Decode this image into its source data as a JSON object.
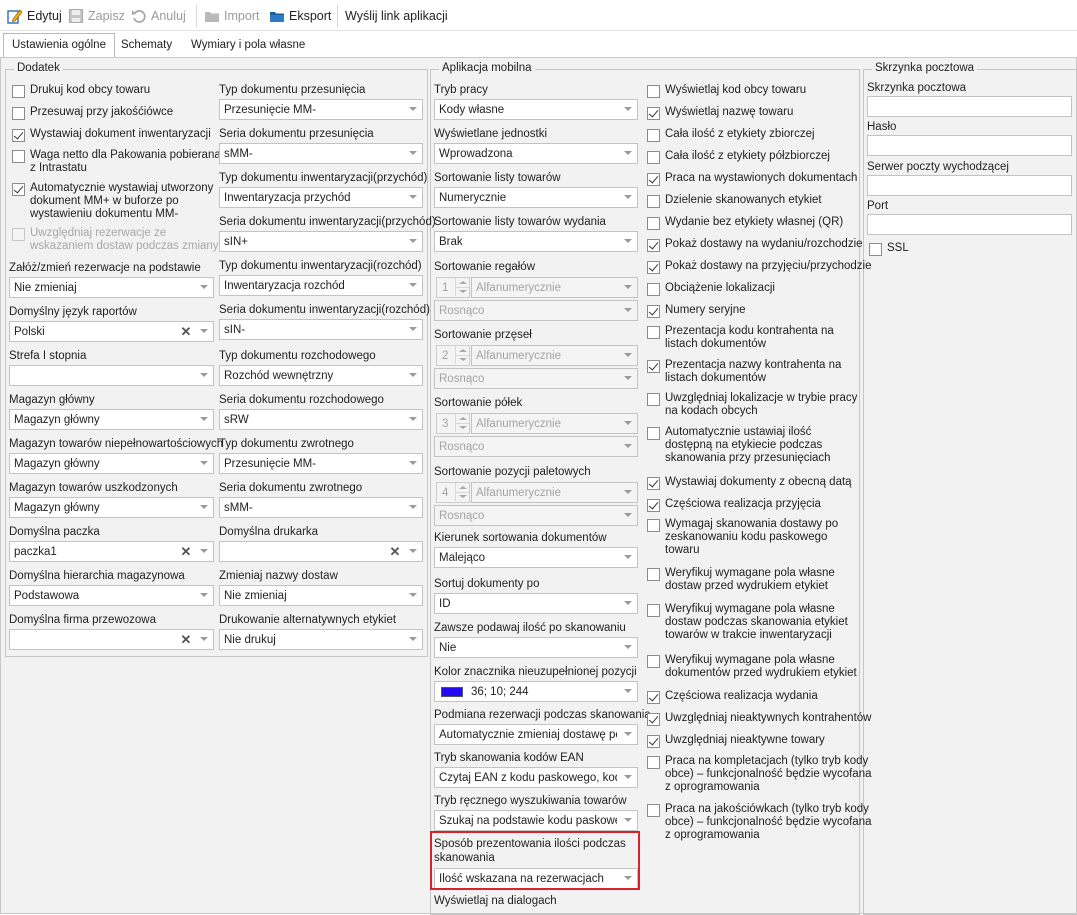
{
  "toolbar": {
    "edit": "Edytuj",
    "save": "Zapisz",
    "cancel": "Anuluj",
    "import": "Import",
    "export": "Eksport",
    "send_link": "Wyślij link aplikacji"
  },
  "tabs": [
    "Ustawienia ogólne",
    "Schematy",
    "Wymiary i pola własne"
  ],
  "dodatek": {
    "title": "Dodatek",
    "checkboxes": [
      {
        "label": "Drukuj kod obcy towaru",
        "checked": false
      },
      {
        "label": "Przesuwaj przy jakośćiówce",
        "checked": false
      },
      {
        "label": "Wystawiaj dokument inwentaryzacji",
        "checked": true
      },
      {
        "label": "Waga netto dla Pakowania pobierana\nz Intrastatu",
        "checked": false
      },
      {
        "label": "Automatycznie wystawiaj utworzony\ndokument MM+ w buforze po\nwystawieniu dokumentu MM-",
        "checked": true
      },
      {
        "label": "Uwzględniaj rezerwacje ze\nwskazaniem dostaw podczas zmiany",
        "checked": false,
        "disabled": true
      }
    ],
    "left_fields": [
      {
        "label": "Załóż/zmień rezerwacje na podstawie",
        "value": "Nie zmieniaj"
      },
      {
        "label": "Domyślny język raportów",
        "value": "Polski"
      },
      {
        "label": "Strefa I stopnia",
        "value": ""
      },
      {
        "label": "Magazyn główny",
        "value": "Magazyn główny"
      },
      {
        "label": "Magazyn towarów niepełnowartościowych",
        "value": "Magazyn główny"
      },
      {
        "label": "Magazyn towarów uszkodzonych",
        "value": "Magazyn główny"
      },
      {
        "label": "Domyślna paczka",
        "value": "paczka1"
      },
      {
        "label": "Domyślna hierarchia magazynowa",
        "value": "Podstawowa"
      },
      {
        "label": "Domyślna firma przewozowa",
        "value": ""
      }
    ],
    "right_fields": [
      {
        "label": "Typ dokumentu przesunięcia",
        "value": "Przesunięcie MM-"
      },
      {
        "label": "Seria dokumentu przesunięcia",
        "value": "sMM-"
      },
      {
        "label": "Typ dokumentu inwentaryzacji(przychód)",
        "value": "Inwentaryzacja przychód"
      },
      {
        "label": "Seria dokumentu inwentaryzacji(przychód)",
        "value": "sIN+"
      },
      {
        "label": "Typ dokumentu inwentaryzacji(rozchód)",
        "value": "Inwentaryzacja rozchód"
      },
      {
        "label": "Seria dokumentu inwentaryzacji(rozchód)",
        "value": "sIN-"
      },
      {
        "label": "Typ dokumentu rozchodowego",
        "value": "Rozchód wewnętrzny"
      },
      {
        "label": "Seria dokumentu rozchodowego",
        "value": "sRW"
      },
      {
        "label": "Typ dokumentu zwrotnego",
        "value": "Przesunięcie MM-"
      },
      {
        "label": "Seria dokumentu zwrotnego",
        "value": "sMM-"
      },
      {
        "label": "Domyślna drukarka",
        "value": ""
      },
      {
        "label": "Zmieniaj nazwy dostaw",
        "value": "Nie zmieniaj"
      },
      {
        "label": "Drukowanie alternatywnych etykiet",
        "value": "Nie drukuj"
      }
    ]
  },
  "mobile": {
    "title": "Aplikacja mobilna",
    "tryb_pracy": {
      "label": "Tryb pracy",
      "value": "Kody własne"
    },
    "jednostki": {
      "label": "Wyświetlane jednostki",
      "value": "Wprowadzona"
    },
    "sort_list": {
      "label": "Sortowanie listy towarów",
      "value": "Numerycznie"
    },
    "sort_list_wyd": {
      "label": "Sortowanie listy towarów wydania",
      "value": "Brak"
    },
    "sort_regal": {
      "label": "Sortowanie regałów",
      "num": "1",
      "mode": "Alfanumerycznie",
      "order": "Rosnąco"
    },
    "sort_przesel": {
      "label": "Sortowanie przęseł",
      "num": "2",
      "mode": "Alfanumerycznie",
      "order": "Rosnąco"
    },
    "sort_polek": {
      "label": "Sortowanie półek",
      "num": "3",
      "mode": "Alfanumerycznie",
      "order": "Rosnąco"
    },
    "sort_palet": {
      "label": "Sortowanie pozycji paletowych",
      "num": "4",
      "mode": "Alfanumerycznie",
      "order": "Rosnąco"
    },
    "kierunek": {
      "label": "Kierunek sortowania dokumentów",
      "value": "Malejąco"
    },
    "sortuj_po": {
      "label": "Sortuj dokumenty po",
      "value": "ID"
    },
    "zawsze_ilosc": {
      "label": "Zawsze podawaj ilość po skanowaniu",
      "value": "Nie"
    },
    "kolor": {
      "label": "Kolor znacznika nieuzupełnionej pozycji",
      "value": "36; 10; 244",
      "color": "#240af4"
    },
    "podmiana": {
      "label": "Podmiana rezerwacji podczas skanowania",
      "value": "Automatycznie zmieniaj dostawę po…"
    },
    "tryb_ean": {
      "label": "Tryb skanowania kodów EAN",
      "value": "Czytaj EAN z kodu paskowego, kod…"
    },
    "tryb_reczny": {
      "label": "Tryb ręcznego wyszukiwania towarów",
      "value": "Szukaj na podstawie kodu paskowe…"
    },
    "sposob": {
      "label": "Sposób prezentowania ilości podczas\nskanowania",
      "value": "Ilość wskazana na rezerwacjach"
    },
    "wyswietlaj_dialog": {
      "label": "Wyświetlaj na dialogach"
    },
    "checkboxes": [
      {
        "label": "Wyświetlaj kod obcy towaru",
        "checked": false
      },
      {
        "label": "Wyświetlaj nazwę towaru",
        "checked": true
      },
      {
        "label": "Cała ilość z etykiety zbiorczej",
        "checked": false
      },
      {
        "label": "Cała ilość z etykiety półzbiorczej",
        "checked": false
      },
      {
        "label": "Praca na wystawionych dokumentach",
        "checked": true
      },
      {
        "label": "Dzielenie skanowanych etykiet",
        "checked": false
      },
      {
        "label": "Wydanie bez etykiety własnej (QR)",
        "checked": false
      },
      {
        "label": "Pokaż dostawy na wydaniu/rozchodzie",
        "checked": true
      },
      {
        "label": "Pokaż dostawy na przyjęciu/przychodzie",
        "checked": true
      },
      {
        "label": "Obciążenie lokalizacji",
        "checked": false
      },
      {
        "label": "Numery seryjne",
        "checked": true
      },
      {
        "label": "Prezentacja kodu kontrahenta na\nlistach dokumentów",
        "checked": false
      },
      {
        "label": "Prezentacja nazwy kontrahenta na\nlistach dokumentów",
        "checked": true
      },
      {
        "label": "Uwzględniaj lokalizacje w trybie pracy\nna kodach obcych",
        "checked": false
      },
      {
        "label": "Automatycznie ustawiaj ilość\ndostępną na etykiecie podczas\nskanowania przy przesunięciach",
        "checked": false
      },
      {
        "label": "Wystawiaj dokumenty z obecną datą",
        "checked": true
      },
      {
        "label": "Częściowa realizacja przyjęcia",
        "checked": true
      },
      {
        "label": "Wymagaj skanowania dostawy po\nzeskanowaniu kodu paskowego\ntowaru",
        "checked": false
      },
      {
        "label": "Weryfikuj wymagane pola własne\ndostaw przed wydrukiem etykiet",
        "checked": false
      },
      {
        "label": "Weryfikuj wymagane pola własne\ndostaw podczas skanowania etykiet\ntowarów w trakcie inwentaryzacji",
        "checked": false
      },
      {
        "label": "Weryfikuj wymagane pola własne\ndokumentów przed wydrukiem etykiet",
        "checked": false
      },
      {
        "label": "Częściowa realizacja wydania",
        "checked": true
      },
      {
        "label": "Uwzględniaj nieaktywnych kontrahentów",
        "checked": true
      },
      {
        "label": "Uwzględniaj nieaktywne towary",
        "checked": true
      },
      {
        "label": "Praca na kompletacjach (tylko tryb kody\nobce) – funkcjonalność będzie wycofana\nz oprogramowania",
        "checked": false
      },
      {
        "label": "Praca na jakościówkach (tylko tryb kody\nobce) – funkcjonalność będzie wycofana\nz oprogramowania",
        "checked": false
      }
    ]
  },
  "mailbox": {
    "title": "Skrzynka pocztowa",
    "fields": [
      {
        "label": "Skrzynka pocztowa",
        "value": ""
      },
      {
        "label": "Hasło",
        "value": ""
      },
      {
        "label": "Serwer poczty wychodzącej",
        "value": ""
      },
      {
        "label": "Port",
        "value": ""
      }
    ],
    "ssl": {
      "label": "SSL",
      "checked": false
    }
  }
}
